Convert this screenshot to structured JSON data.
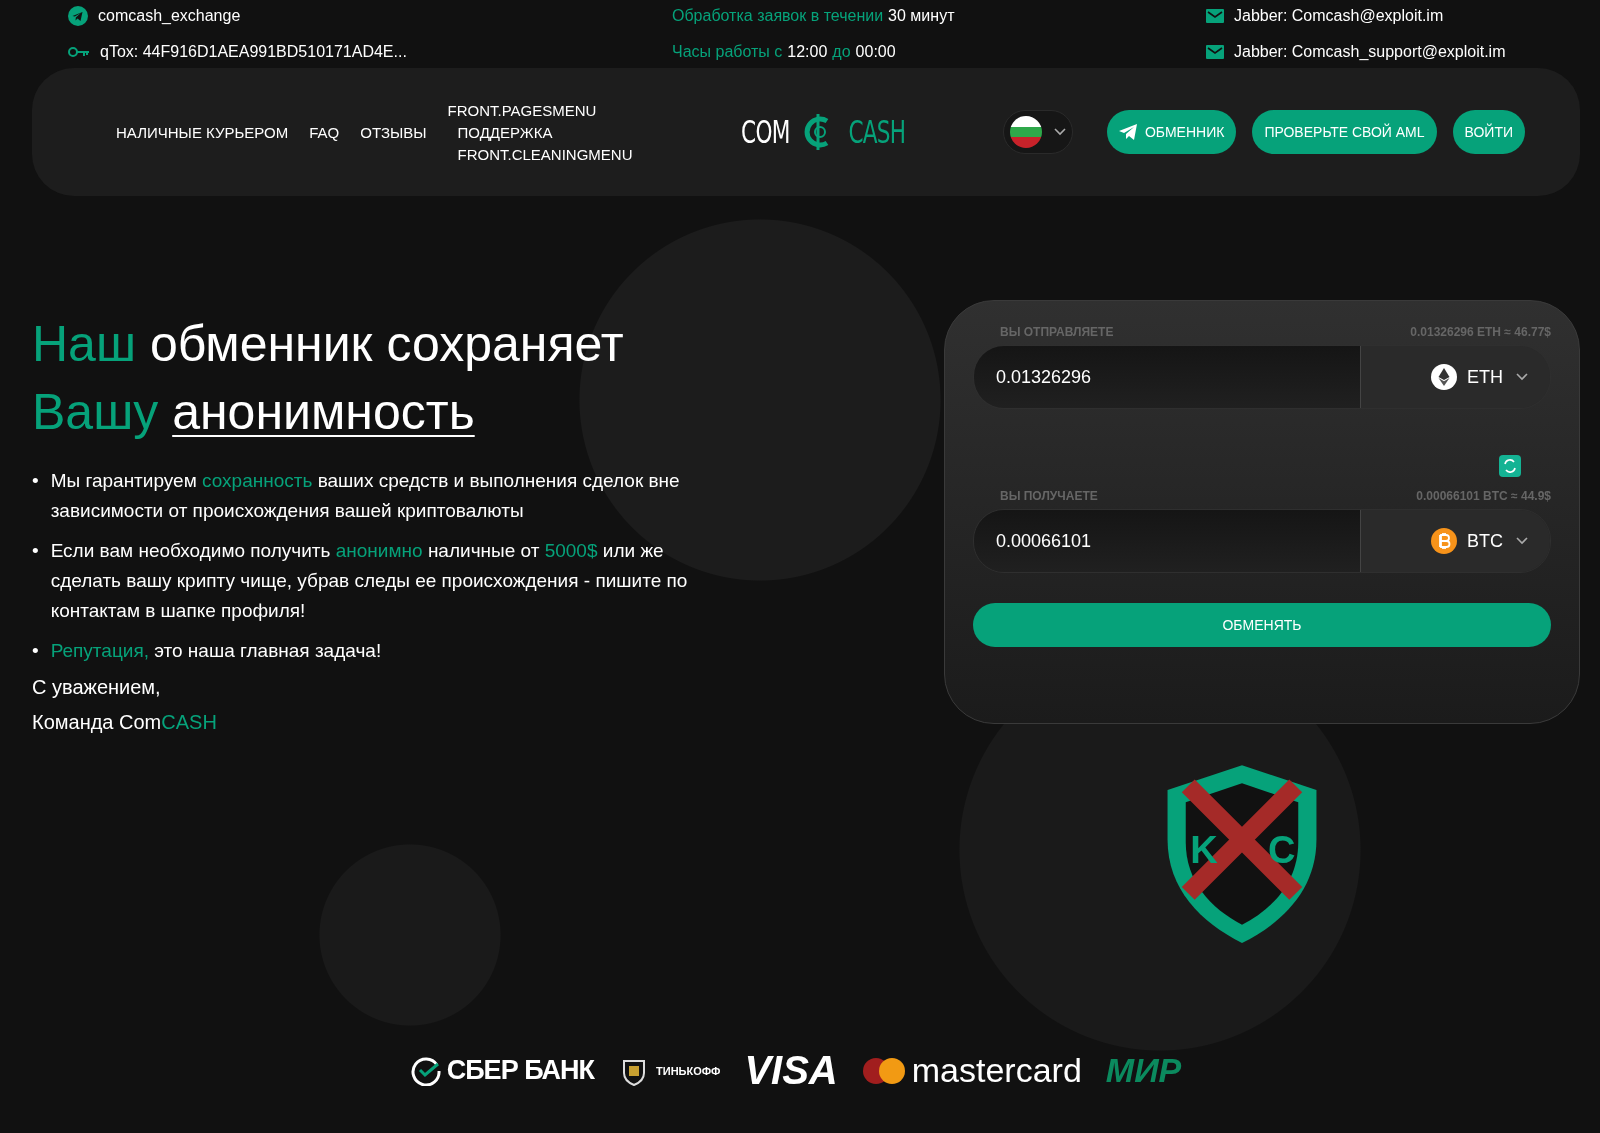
{
  "top_bar": {
    "left": [
      {
        "kind": "telegram",
        "text": "comcash_exchange"
      },
      {
        "kind": "key",
        "text": "qTox: 44F916D1AEA991BD510171AD4E..."
      }
    ],
    "center": [
      [
        {
          "text": "Обработка заявок в течении",
          "accent": true
        },
        {
          "text": "30 минут",
          "accent": false
        }
      ],
      [
        {
          "text": "Часы работы с",
          "accent": true
        },
        {
          "text": "12:00",
          "accent": false
        },
        {
          "text": "до",
          "accent": true
        },
        {
          "text": "00:00",
          "accent": false
        }
      ]
    ],
    "right": [
      {
        "kind": "mail",
        "text": "Jabber: Comcash@exploit.im"
      },
      {
        "kind": "mail",
        "text": "Jabber: Comcash_support@exploit.im"
      }
    ]
  },
  "nav": {
    "items": [
      {
        "label": "НАЛИЧНЫЕ КУРЬЕРОМ"
      },
      {
        "label": "FAQ"
      },
      {
        "label": "ОТЗЫВЫ"
      },
      {
        "label": "FRONT.PAGESMENU",
        "children": [
          {
            "label": "ПОДДЕРЖКА"
          },
          {
            "label": "FRONT.CLEANINGMENU"
          }
        ]
      }
    ],
    "logo": {
      "left": "COM",
      "right": "CASH"
    },
    "buttons": [
      {
        "label": "ОБМЕННИК",
        "kind": "telegram"
      },
      {
        "label": "ПРОВЕРЬТЕ СВОЙ AML",
        "kind": "plain"
      },
      {
        "label": "ВОЙТИ",
        "kind": "plain"
      }
    ]
  },
  "hero": {
    "title": [
      [
        {
          "text": "Наш",
          "kind": "accent"
        },
        {
          "text": "обменник сохраняет",
          "kind": "plain"
        }
      ],
      [
        {
          "text": "Вашу",
          "kind": "accent"
        },
        {
          "text": "анонимность",
          "kind": "underline"
        }
      ]
    ],
    "marker": "•",
    "bullets": [
      [
        {
          "text": "Мы гарантируем",
          "accent": false
        },
        {
          "text": "сохранность",
          "accent": true
        },
        {
          "text": "ваших средств и выполнения сделок вне зависимости от происхождения вашей криптовалюты",
          "accent": false
        }
      ],
      [
        {
          "text": "Если вам необходимо получить",
          "accent": false
        },
        {
          "text": "анонимно",
          "accent": true
        },
        {
          "text": "наличные от",
          "accent": false
        },
        {
          "text": "5000$",
          "accent": true
        },
        {
          "text": "или же сделать вашу крипту чище, убрав следы ее происхождения - пишите по контактам в шапке профиля!",
          "accent": false
        }
      ],
      [
        {
          "text": "Репутация,",
          "accent": true
        },
        {
          "text": "это наша главная задача!",
          "accent": false
        }
      ]
    ],
    "signoff": [
      [
        {
          "text": "С уважением,",
          "accent": false
        }
      ],
      [
        {
          "text": "Команда Com",
          "accent": false
        },
        {
          "text": "CASH",
          "accent": true
        }
      ]
    ]
  },
  "exchange": {
    "rows": [
      {
        "label": "ВЫ ОТПРАВЛЯЕТЕ",
        "rate": "0.01326296 ETH ≈ 46.77$",
        "amount": "0.01326296",
        "currency": "ETH",
        "kind": "eth"
      },
      {
        "label": "ВЫ ПОЛУЧАЕТЕ",
        "rate": "0.00066101 BTC ≈ 44.9$",
        "amount": "0.00066101",
        "currency": "BTC",
        "kind": "btc"
      }
    ],
    "submit": "ОБМЕНЯТЬ"
  },
  "kyc_badge": {
    "letters": [
      "K",
      "C"
    ]
  },
  "payments": [
    {
      "kind": "sber",
      "text": "СБЕР БАНК"
    },
    {
      "kind": "tinkoff",
      "text": "ТИНЬКОФФ"
    },
    {
      "kind": "visa",
      "text": "VISA"
    },
    {
      "kind": "mastercard",
      "text": "mastercard"
    },
    {
      "kind": "mir",
      "text": "МИР"
    }
  ]
}
